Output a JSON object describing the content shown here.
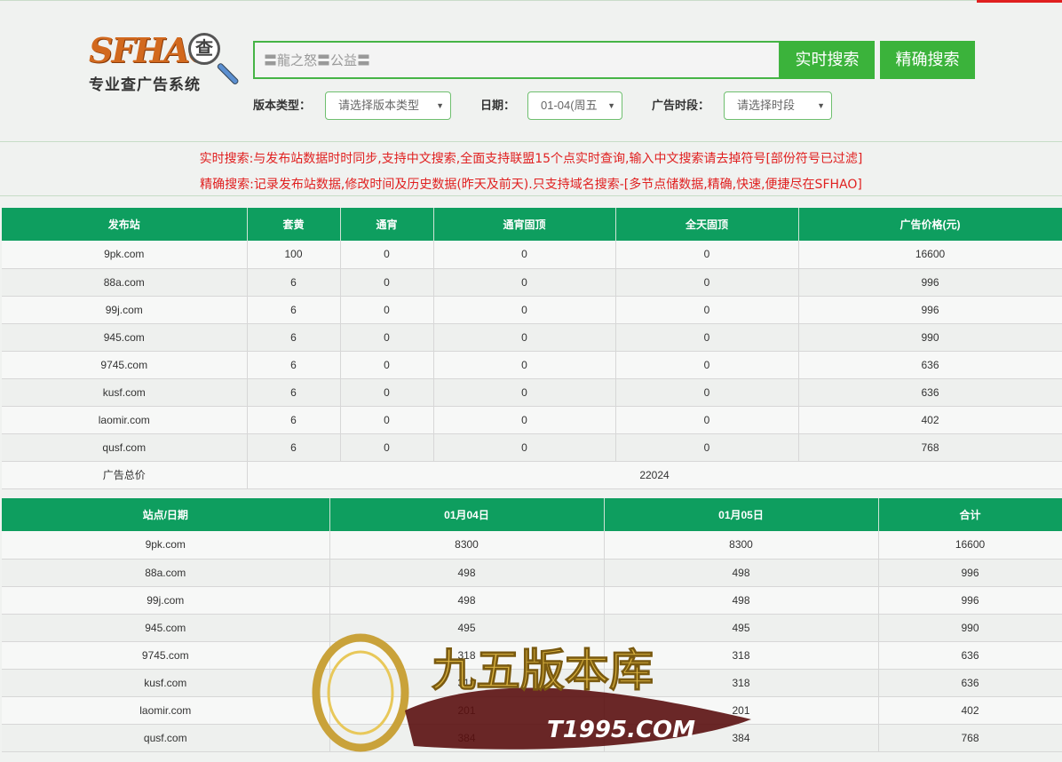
{
  "logo": {
    "brand": "SFHAO",
    "search_glyph": "查",
    "tagline": "专业查广告系统"
  },
  "search": {
    "value": "〓龍之怒〓公益〓",
    "realtime_label": "实时搜索",
    "exact_label": "精确搜索"
  },
  "filters": {
    "version_label": "版本类型：",
    "version_value": "请选择版本类型",
    "date_label": "日期：",
    "date_value": "01-04(周五",
    "period_label": "广告时段：",
    "period_value": "请选择时段"
  },
  "notices": {
    "realtime": "实时搜索:与发布站数据时时同步,支持中文搜索,全面支持联盟15个点实时查询,输入中文搜索请去掉符号[部份符号已过滤]",
    "exact": "精确搜索:记录发布站数据,修改时间及历史数据(昨天及前天).只支持域名搜索-[多节点储数据,精确,快速,便捷尽在SFHAO]"
  },
  "table1": {
    "headers": [
      "发布站",
      "套黄",
      "通宵",
      "通宵固顶",
      "全天固顶",
      "广告价格(元)"
    ],
    "rows": [
      [
        "9pk.com",
        "100",
        "0",
        "0",
        "0",
        "16600"
      ],
      [
        "88a.com",
        "6",
        "0",
        "0",
        "0",
        "996"
      ],
      [
        "99j.com",
        "6",
        "0",
        "0",
        "0",
        "996"
      ],
      [
        "945.com",
        "6",
        "0",
        "0",
        "0",
        "990"
      ],
      [
        "9745.com",
        "6",
        "0",
        "0",
        "0",
        "636"
      ],
      [
        "kusf.com",
        "6",
        "0",
        "0",
        "0",
        "636"
      ],
      [
        "laomir.com",
        "6",
        "0",
        "0",
        "0",
        "402"
      ],
      [
        "qusf.com",
        "6",
        "0",
        "0",
        "0",
        "768"
      ]
    ],
    "total_label": "广告总价",
    "total_value": "22024"
  },
  "table2": {
    "headers": [
      "站点/日期",
      "01月04日",
      "01月05日",
      "合计"
    ],
    "rows": [
      [
        "9pk.com",
        "8300",
        "8300",
        "16600"
      ],
      [
        "88a.com",
        "498",
        "498",
        "996"
      ],
      [
        "99j.com",
        "498",
        "498",
        "996"
      ],
      [
        "945.com",
        "495",
        "495",
        "990"
      ],
      [
        "9745.com",
        "318",
        "318",
        "636"
      ],
      [
        "kusf.com",
        "318",
        "318",
        "636"
      ],
      [
        "laomir.com",
        "201",
        "201",
        "402"
      ],
      [
        "qusf.com",
        "384",
        "384",
        "768"
      ]
    ]
  },
  "watermark": {
    "title": "九五版本库",
    "site": "T1995.COM"
  }
}
